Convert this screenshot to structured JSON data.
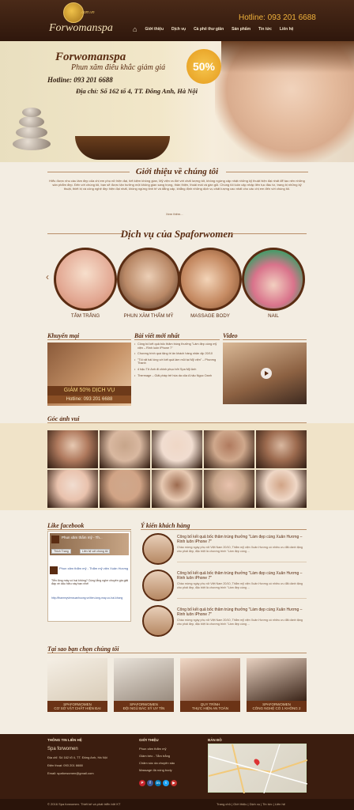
{
  "header": {
    "logo_text": "Forwomanspa",
    "logo_domain": ".com.vn",
    "hotline": "Hotline: 093 201 6688",
    "nav": [
      "Giới thiệu",
      "Dịch vụ",
      "Cà phê thư giãn",
      "Sản phẩm",
      "Tin tức",
      "Liên hệ"
    ]
  },
  "banner": {
    "title": "Forwomanspa",
    "subtitle": "Phun xăm điêu khắc giảm giá",
    "badge": "50%",
    "hotline": "Hotline: 093 201 6688",
    "address": "Địa chỉ: Số 162 tổ 4, TT. Đông Anh, Hà Nội"
  },
  "intro": {
    "title": "Giới thiệu về chúng tôi",
    "text": "Hiểu được nhu cầu làm đẹp của chị em phụ nữ hiện đại, tiết kiệm không gian, Mỹ viện ra đời với chất lượng tốt, không ngừng cập nhật những kỹ thuật hiện đại nhất để tạo nên những sản phẩm đẹp. Đến với chúng tôi, bạn sẽ được tận hưởng một không gian sang trọng, thân thiện, thoải mái và gần gũi. Chúng tôi luôn cập nhập liên tục đầu tư, trang bị những kỹ thuật, thiết bị và công nghệ đẹp hiện đại nhất, không ngừng tinh tế và đẳng cấp, khẳng định những dịch vụ chất lượng cao nhất cho các chị em đến với chúng tôi.",
    "more": "Xem thêm..."
  },
  "services": {
    "title": "Dịch vụ của Spaforwomen",
    "items": [
      "TẮM TRẮNG",
      "PHUN XĂM THẨM MỸ",
      "MASSAGE BODY",
      "NAIL"
    ]
  },
  "promo": {
    "title": "Khuyến mại",
    "band": "GIẢM 50% DỊCH VỤ",
    "hotline": "Hotline: 093 201 6688"
  },
  "news": {
    "title": "Bài viết mới nhất",
    "items": [
      "Công bố kết quả bốc thăm trúng thưởng \"Làm đẹp cùng mỹ viện – Rinh luôn iPhone 7\"",
      "Chương trình quà tặng tri ân khách hàng nhân dịp 20/10",
      "\"Tôi rất hài lòng với kết quả làm mũi tại Mỹ viện\" – Phương Thanh",
      "4 hậu Tử Anh đi chinh phục bởi Spa Mỹ Anh",
      "Thermage – Giải pháp trẻ hóa da của A hậu Ngọc Oanh"
    ]
  },
  "video": {
    "title": "Video"
  },
  "gallery": {
    "title": "Góc ảnh vui"
  },
  "facebook": {
    "title": "Like facebook",
    "page_name": "Phun xăm thẩm mỹ - Th...",
    "likes": "Thích Trang",
    "share": "Liên hệ với chúng tôi",
    "post_name": "Phun xăm thẩm mỹ - Thẩm mỹ viện Xuân Hương",
    "post_text": "Tiễn lông máy có hại không? Cùng lắng nghe chuyên gia giải đáp về dấu hiệu này bạn nhé!",
    "post_link": "http://thammyvienxuanhuong.vn/tien-long-may-co-hai-khong"
  },
  "comments": {
    "title": "Ý kiến khách hàng",
    "items": [
      {
        "title": "Công bố kết quả bốc thăm trúng thưởng \"Làm đẹp cùng Xuân Hương – Rinh luôn iPhone 7\"",
        "body": "Chào mừng ngày phụ nữ Việt Nam 20/10, Thẩm mỹ viện Xuân Hương có nhiều ưu đãi dành tặng cho phái đẹp, đặc biệt là chương trình \"Làm đẹp cùng ..."
      },
      {
        "title": "Công bố kết quả bốc thăm trúng thưởng \"Làm đẹp cùng Xuân Hương – Rinh luôn iPhone 7\"",
        "body": "Chào mừng ngày phụ nữ Việt Nam 20/10, Thẩm mỹ viện Xuân Hương có nhiều ưu đãi dành tặng cho phái đẹp, đặc biệt là chương trình \"Làm đẹp cùng ..."
      },
      {
        "title": "Công bố kết quả bốc thăm trúng thưởng \"Làm đẹp cùng Xuân Hương – Rinh luôn iPhone 7\"",
        "body": "Chào mừng ngày phụ nữ Việt Nam 20/10, Thẩm mỹ viện Xuân Hương có nhiều ưu đãi dành tặng cho phái đẹp, đặc biệt là chương trình \"Làm đẹp cùng ..."
      }
    ]
  },
  "why": {
    "title": "Tại sao bạn chọn chúng tôi",
    "items": [
      [
        "SPAFORWOMEN",
        "CƠ SỞ VẬT CHẤT HIỆN ĐẠI"
      ],
      [
        "SPAFORWOMEN",
        "ĐỘI NGŨ BÁC SỸ UY TÍN"
      ],
      [
        "QUY TRÌNH",
        "THỰC HIỆN AN TOÀN"
      ],
      [
        "SPAFORWOMEN",
        "CÔNG NGHỆ CÓ 1 KHÔNG 2"
      ]
    ]
  },
  "footer": {
    "contact_title": "THÔNG TIN LIÊN HỆ",
    "company": "Spa forwomen",
    "address": "Địa chỉ: Số 162 tổ 4, TT. Đông Anh, Hà Nội",
    "phone": "Điện thoại: 093 201 6688",
    "email": "Email: spaforwomen@gmail.com",
    "intro_title": "GIỚI THIỆU",
    "links": [
      "Phun xăm thẩm mỹ",
      "Giảm béo - Tắm trắng",
      "Chăm sóc da chuyên sâu",
      "Massage đá nóng body"
    ],
    "map_title": "BẢN ĐỒ",
    "copyright": "© 2016 Spa forwomen. Thiết kế và phát triển bởi KT",
    "bottom_links": [
      "Trang chủ",
      "Giới thiệu",
      "Dịch vụ",
      "Tin tức",
      "Liên hệ"
    ]
  },
  "colors": {
    "brand": "#5a2c12",
    "accent": "#f0b23c",
    "background": "#f3ede2"
  }
}
